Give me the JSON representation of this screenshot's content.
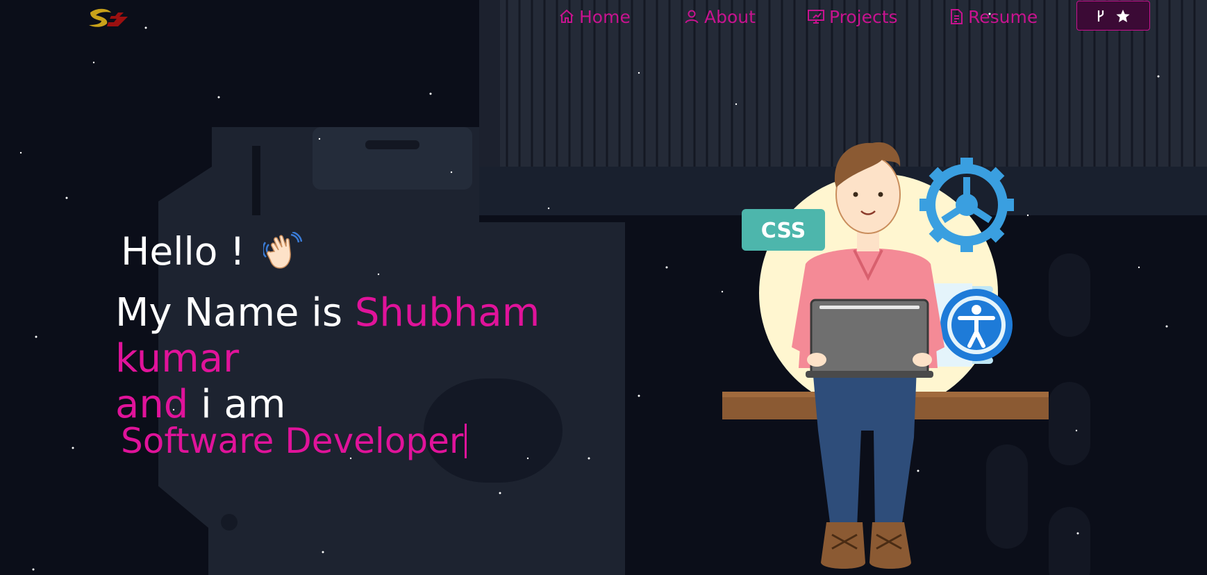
{
  "nav": {
    "home_label": "Home",
    "about_label": "About",
    "projects_label": "Projects",
    "resume_label": "Resume"
  },
  "hero": {
    "greeting": "Hello !",
    "name_intro": "My Name is ",
    "name_highlight": "Shubham kumar",
    "and_word": "and",
    "i_am": " i am",
    "role": "Software Developer"
  },
  "illustration": {
    "css_badge": "CSS"
  },
  "colors": {
    "accent": "#e0139a",
    "nav_text": "#c7138f",
    "background": "#0c0f1a",
    "button_bg": "#3b0a35"
  },
  "icons": [
    "home-icon",
    "user-icon",
    "projects-icon",
    "document-icon",
    "fork-icon",
    "star-icon",
    "wave-hand-icon"
  ]
}
